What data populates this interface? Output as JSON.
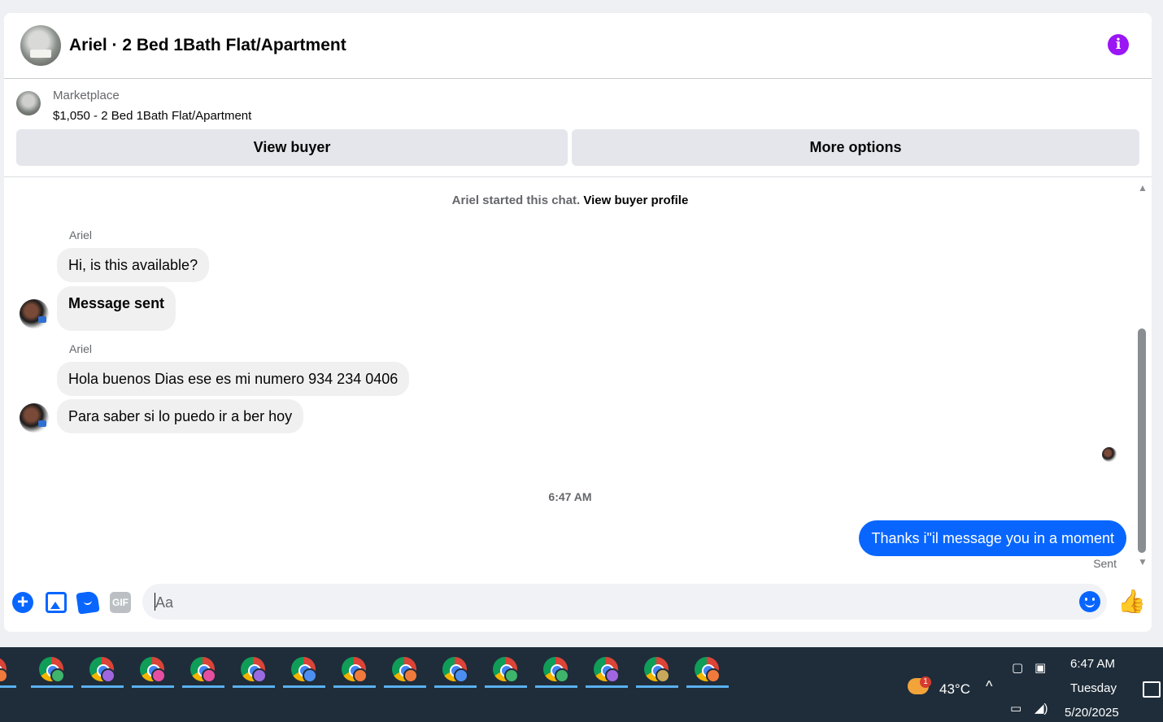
{
  "header": {
    "title": "Ariel · 2 Bed 1Bath Flat/Apartment",
    "info_icon": "info-icon"
  },
  "listing": {
    "label": "Marketplace",
    "price_title": "$1,050 - 2 Bed 1Bath Flat/Apartment",
    "view_buyer": "View buyer",
    "more_options": "More options"
  },
  "chat": {
    "started_text": "Ariel started this chat.",
    "view_profile": "View buyer profile",
    "messages": [
      {
        "sender": "Ariel",
        "text": "Hi, is this available?"
      },
      {
        "text": "Message sent"
      },
      {
        "sender": "Ariel",
        "text": "Hola buenos Dias ese es mi numero 934 234 0406"
      },
      {
        "text": "Para saber si lo puedo ir a ber hoy"
      }
    ],
    "timestamp": "6:47 AM",
    "outgoing": "Thanks i\"il message you in a moment",
    "status": "Sent"
  },
  "composer": {
    "placeholder": "Aa",
    "gif_label": "GIF"
  },
  "taskbar": {
    "badge_colors": [
      "#f07a3c",
      "#3fb46b",
      "#a066e0",
      "#e64fa0",
      "#e64fa0",
      "#9a6be0",
      "#4d8ff0",
      "#f07a3c",
      "#f07a3c",
      "#4d8ff0",
      "#3fb46b",
      "#3fb46b",
      "#a066e0",
      "#c8a85a",
      "#f07a3c"
    ],
    "weather_badge": "1",
    "temperature": "43°C",
    "time": "6:47 AM",
    "day": "Tuesday",
    "date": "5/20/2025"
  }
}
